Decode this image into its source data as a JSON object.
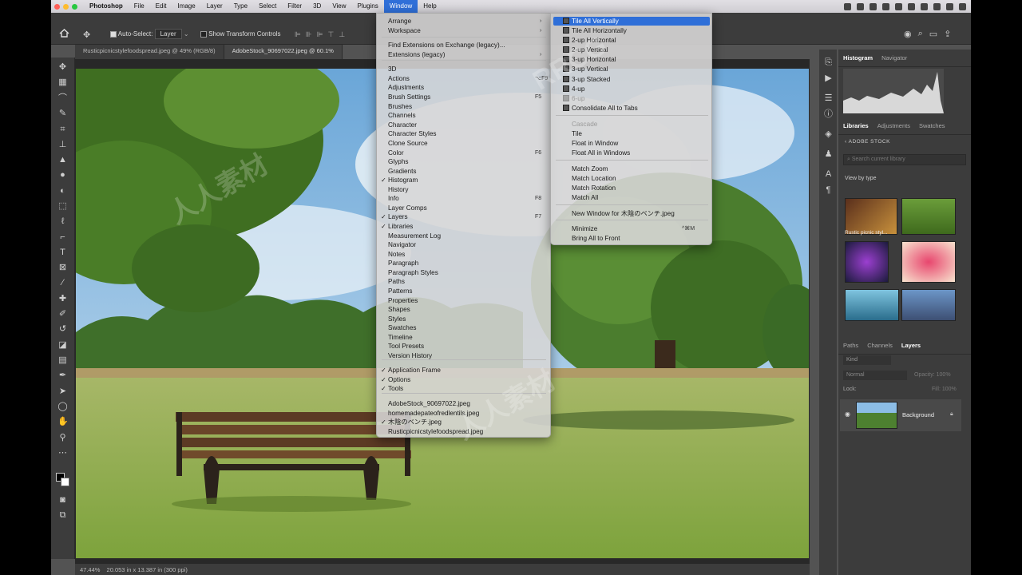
{
  "menubar": {
    "app": "Photoshop",
    "items": [
      "File",
      "Edit",
      "Image",
      "Layer",
      "Type",
      "Select",
      "Filter",
      "3D",
      "View",
      "Plugins",
      "Window",
      "Help"
    ],
    "active": "Window"
  },
  "optbar": {
    "auto_select_label": "Auto-Select:",
    "auto_select_value": "Layer",
    "transform_label": "Show Transform Controls"
  },
  "tabs": [
    {
      "label": "Rusticpicnicstylefoodspread.jpeg @ 49% (RGB/8)"
    },
    {
      "label": "AdobeStock_90697022.jpeg @ 60.1%"
    }
  ],
  "statusbar": {
    "zoom": "47.44%",
    "info": "20.053 in x 13.387 in (300 ppi)"
  },
  "window_menu": {
    "items": [
      {
        "label": "Arrange",
        "sub": true
      },
      {
        "label": "Workspace",
        "sub": true
      },
      {
        "label": "Find Extensions on Exchange (legacy)..."
      },
      {
        "label": "Extensions (legacy)",
        "sub": true
      },
      {
        "label": "3D"
      },
      {
        "label": "Actions",
        "shortcut": "⌥F9"
      },
      {
        "label": "Adjustments"
      },
      {
        "label": "Brush Settings",
        "shortcut": "F5"
      },
      {
        "label": "Brushes"
      },
      {
        "label": "Channels"
      },
      {
        "label": "Character"
      },
      {
        "label": "Character Styles"
      },
      {
        "label": "Clone Source"
      },
      {
        "label": "Color",
        "shortcut": "F6"
      },
      {
        "label": "Glyphs"
      },
      {
        "label": "Gradients"
      },
      {
        "label": "Histogram",
        "checked": true
      },
      {
        "label": "History"
      },
      {
        "label": "Info",
        "shortcut": "F8"
      },
      {
        "label": "Layer Comps"
      },
      {
        "label": "Layers",
        "checked": true,
        "shortcut": "F7"
      },
      {
        "label": "Libraries",
        "checked": true
      },
      {
        "label": "Measurement Log"
      },
      {
        "label": "Navigator"
      },
      {
        "label": "Notes"
      },
      {
        "label": "Paragraph"
      },
      {
        "label": "Paragraph Styles"
      },
      {
        "label": "Paths"
      },
      {
        "label": "Patterns"
      },
      {
        "label": "Properties"
      },
      {
        "label": "Shapes"
      },
      {
        "label": "Styles"
      },
      {
        "label": "Swatches"
      },
      {
        "label": "Timeline"
      },
      {
        "label": "Tool Presets"
      },
      {
        "label": "Version History"
      },
      {
        "label": "Application Frame",
        "checked": true
      },
      {
        "label": "Options",
        "checked": true
      },
      {
        "label": "Tools",
        "checked": true
      },
      {
        "label": "AdobeStock_90697022.jpeg"
      },
      {
        "label": "homemadepateofredlentils.jpeg"
      },
      {
        "label": "木陰のベンチ.jpeg",
        "checked": true
      },
      {
        "label": "Rusticpicnicstylefoodspread.jpeg"
      }
    ]
  },
  "arrange_submenu": {
    "items": [
      {
        "label": "Tile All Vertically",
        "highlighted": true
      },
      {
        "label": "Tile All Horizontally"
      },
      {
        "label": "2-up Horizontal"
      },
      {
        "label": "2-up Vertical"
      },
      {
        "label": "3-up Horizontal"
      },
      {
        "label": "3-up Vertical"
      },
      {
        "label": "3-up Stacked"
      },
      {
        "label": "4-up"
      },
      {
        "label": "6-up",
        "disabled": true
      },
      {
        "label": "Consolidate All to Tabs"
      },
      {
        "label": "Cascade",
        "disabled": true
      },
      {
        "label": "Tile"
      },
      {
        "label": "Float in Window"
      },
      {
        "label": "Float All in Windows"
      },
      {
        "label": "Match Zoom"
      },
      {
        "label": "Match Location"
      },
      {
        "label": "Match Rotation"
      },
      {
        "label": "Match All"
      },
      {
        "label": "New Window for 木陰のベンチ.jpeg"
      },
      {
        "label": "Minimize",
        "shortcut": "^⌘M"
      },
      {
        "label": "Bring All to Front"
      }
    ]
  },
  "panels": {
    "top_tabs": [
      "Histogram",
      "Navigator"
    ],
    "mid_tabs": [
      "Libraries",
      "Adjustments",
      "Swatches"
    ],
    "library_name": "ADOBE STOCK",
    "search_placeholder": "Search current library",
    "view_by": "View by type",
    "thumb_caption": "Rustic picnic styl...",
    "layer_tabs": [
      "Paths",
      "Channels",
      "Layers"
    ],
    "kind": "Kind",
    "blend": "Normal",
    "opacity_label": "Opacity:",
    "opacity_value": "100%",
    "lock_label": "Lock:",
    "fill_label": "Fill:",
    "fill_value": "100%",
    "layer_name": "Background"
  }
}
